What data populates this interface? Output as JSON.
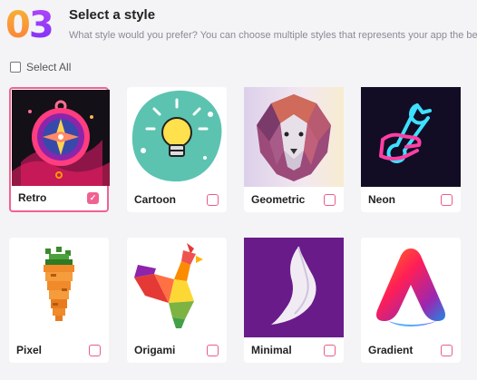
{
  "header": {
    "step_digit_1": "0",
    "step_digit_2": "3",
    "title": "Select a style",
    "subtitle": "What style would you prefer? You can choose multiple styles that represents your app the best."
  },
  "select_all": {
    "label": "Select All",
    "checked": false
  },
  "styles": [
    {
      "label": "Retro",
      "selected": true,
      "icon": "compass-icon"
    },
    {
      "label": "Cartoon",
      "selected": false,
      "icon": "lightbulb-icon"
    },
    {
      "label": "Geometric",
      "selected": false,
      "icon": "lion-icon"
    },
    {
      "label": "Neon",
      "selected": false,
      "icon": "wrench-hand-icon"
    },
    {
      "label": "Pixel",
      "selected": false,
      "icon": "carrot-icon"
    },
    {
      "label": "Origami",
      "selected": false,
      "icon": "rooster-icon"
    },
    {
      "label": "Minimal",
      "selected": false,
      "icon": "feather-icon"
    },
    {
      "label": "Gradient",
      "selected": false,
      "icon": "letter-a-icon"
    }
  ],
  "colors": {
    "accent": "#f06292",
    "step_orange": "#f7a030",
    "step_purple": "#9b3ef8"
  }
}
